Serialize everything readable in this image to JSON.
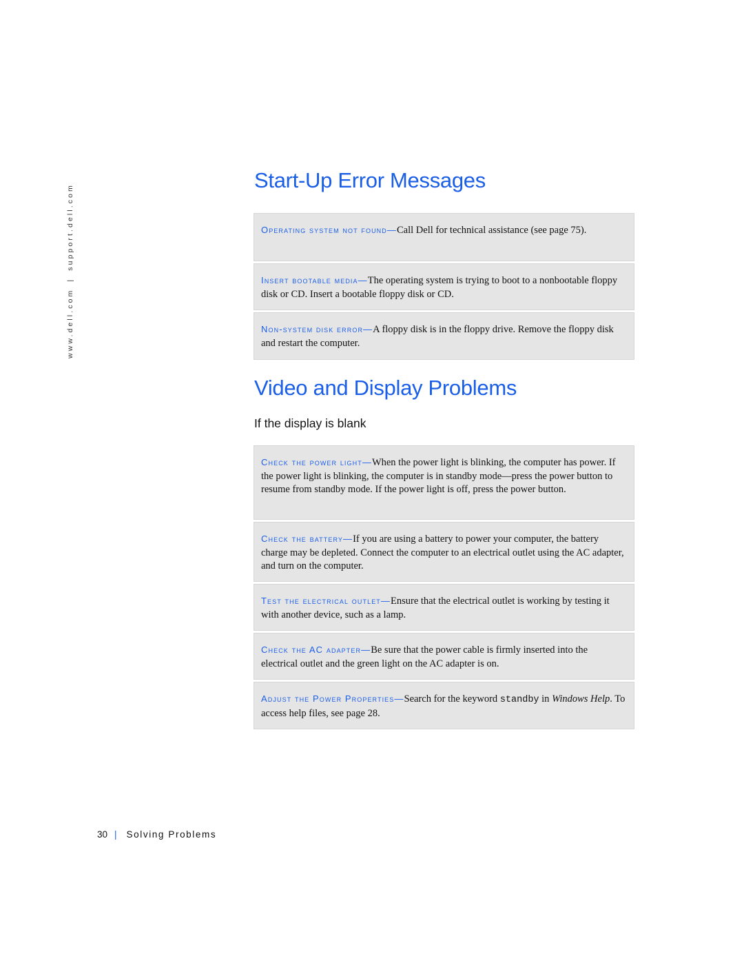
{
  "sidebar": {
    "url_left": "www.dell.com",
    "separator": "|",
    "url_right": "support.dell.com"
  },
  "sections": {
    "startup": {
      "title": "Start-Up Error Messages",
      "items": [
        {
          "term": "Operating system not found—",
          "text": "Call Dell for technical assistance (see page 75)."
        },
        {
          "term": "Insert bootable media—",
          "text": "The operating system is trying to boot to a nonbootable floppy disk or CD. Insert a bootable floppy disk or CD."
        },
        {
          "term": "Non-system disk error—",
          "text": "A floppy disk is in the floppy drive. Remove the floppy disk and restart the computer."
        }
      ]
    },
    "video": {
      "title": "Video and Display Problems",
      "subtitle": "If the display is blank",
      "items": [
        {
          "term": "Check the power light—",
          "text": "When the power light is blinking, the computer has power. If the power light is blinking, the computer is in standby mode—press the power button to resume from standby mode. If the power light is off, press the power button."
        },
        {
          "term": "Check the battery—",
          "text": "If you are using a battery to power your computer, the battery charge may be depleted. Connect the computer to an electrical outlet using the AC adapter, and turn on the computer."
        },
        {
          "term": "Test the electrical outlet—",
          "text": "Ensure that the electrical outlet is working by testing it with another device, such as a lamp."
        },
        {
          "term": "Check the AC adapter—",
          "text": "Be sure that the power cable is firmly inserted into the electrical outlet and the green light on the AC adapter is on."
        },
        {
          "term": "Adjust the Power Properties—",
          "text_before": "Search for the keyword ",
          "keyword": "standby",
          "text_middle": " in ",
          "italic": "Windows Help",
          "text_after": ". To access help files, see page 28."
        }
      ]
    }
  },
  "footer": {
    "page_number": "30",
    "separator": "|",
    "chapter": "Solving Problems"
  },
  "colors": {
    "accent": "#1a5ee8",
    "box_fill": "#e5e5e5",
    "text": "#111111"
  }
}
